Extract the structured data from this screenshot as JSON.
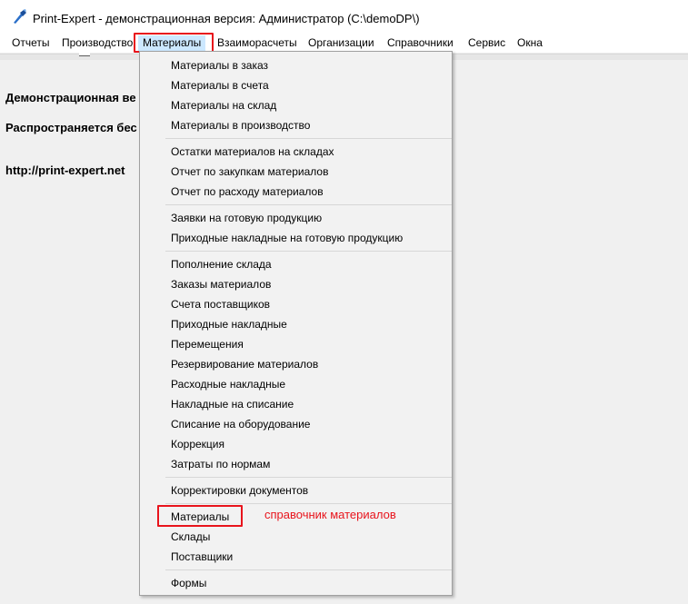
{
  "window": {
    "title": "Print-Expert - демонстрационная версия: Администратор (C:\\demoDP\\)"
  },
  "menubar": {
    "items": [
      {
        "label": "Отчеты"
      },
      {
        "label": "Производство"
      },
      {
        "label": "Материалы"
      },
      {
        "label": "Взаиморасчеты"
      },
      {
        "label": "Организации"
      },
      {
        "label": "Справочники"
      },
      {
        "label": "Сервис"
      },
      {
        "label": "Окна"
      }
    ],
    "active": "Материалы"
  },
  "content": {
    "line1": "Демонстрационная ве",
    "line2": "Распространяется бес",
    "link": "http://print-expert.net"
  },
  "dropdown": {
    "groups": [
      [
        "Материалы в заказ",
        "Материалы в счета",
        "Материалы на склад",
        "Материалы в производство"
      ],
      [
        "Остатки материалов на складах",
        "Отчет по закупкам материалов",
        "Отчет по расходу материалов"
      ],
      [
        "Заявки на готовую продукцию",
        "Приходные накладные на готовую продукцию"
      ],
      [
        "Пополнение склада",
        "Заказы материалов",
        "Счета поставщиков",
        "Приходные накладные",
        "Перемещения",
        "Резервирование материалов",
        "Расходные накладные",
        "Накладные на списание",
        "Списание на оборудование",
        "Коррекция",
        "Затраты по нормам"
      ],
      [
        "Корректировки документов"
      ],
      [
        "Материалы",
        "Склады",
        "Поставщики"
      ],
      [
        "Формы"
      ]
    ]
  },
  "annotation": {
    "text": "справочник материалов",
    "color": "#e8141c"
  },
  "colors": {
    "highlight_box": "#e8141c",
    "menu_active_bg": "#cce8ff",
    "dropdown_bg": "#f2f2f2"
  },
  "icons": {
    "app_icon": "print-expert-app-icon"
  }
}
